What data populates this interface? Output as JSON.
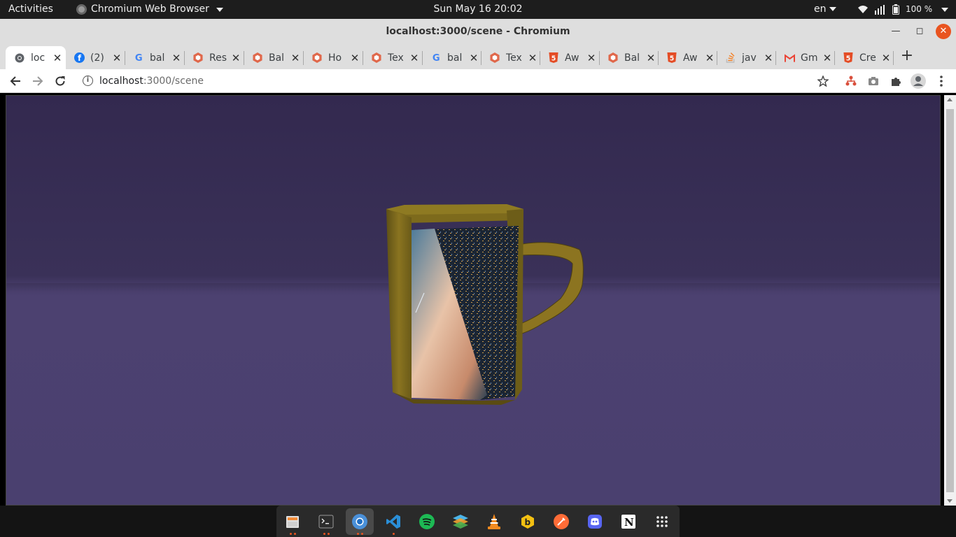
{
  "topbar": {
    "activities": "Activities",
    "app_name": "Chromium Web Browser",
    "clock": "Sun May 16  20:02",
    "language": "en",
    "battery": "100 %"
  },
  "window": {
    "title": "localhost:3000/scene - Chromium"
  },
  "tabs": [
    {
      "title": "loc",
      "icon": "chromium-icon",
      "active": true
    },
    {
      "title": "(2)",
      "icon": "facebook-icon"
    },
    {
      "title": "bal",
      "icon": "google-icon"
    },
    {
      "title": "Res",
      "icon": "babylon-icon"
    },
    {
      "title": "Bal",
      "icon": "babylon-icon"
    },
    {
      "title": "Ho",
      "icon": "babylon-icon"
    },
    {
      "title": "Tex",
      "icon": "babylon-icon"
    },
    {
      "title": "bal",
      "icon": "google-icon"
    },
    {
      "title": "Tex",
      "icon": "babylon-icon"
    },
    {
      "title": "Aw",
      "icon": "html5-icon"
    },
    {
      "title": "Bal",
      "icon": "babylon-icon"
    },
    {
      "title": "Aw",
      "icon": "html5-icon"
    },
    {
      "title": "jav",
      "icon": "stackoverflow-icon"
    },
    {
      "title": "Gm",
      "icon": "gmail-icon"
    },
    {
      "title": "Cre",
      "icon": "html5-icon"
    }
  ],
  "toolbar": {
    "url_host": "localhost",
    "url_path": ":3000/scene"
  },
  "dock": {
    "apps": [
      "files",
      "terminal",
      "chromium",
      "vscode",
      "spotify",
      "layers-app",
      "vlc",
      "bitwarden",
      "postman",
      "discord",
      "notion",
      "show-applications"
    ]
  },
  "colors": {
    "accent": "#e95420",
    "scene_sky": "#33294f",
    "scene_floor": "#4a406f",
    "mug_body": "#8a7420"
  }
}
